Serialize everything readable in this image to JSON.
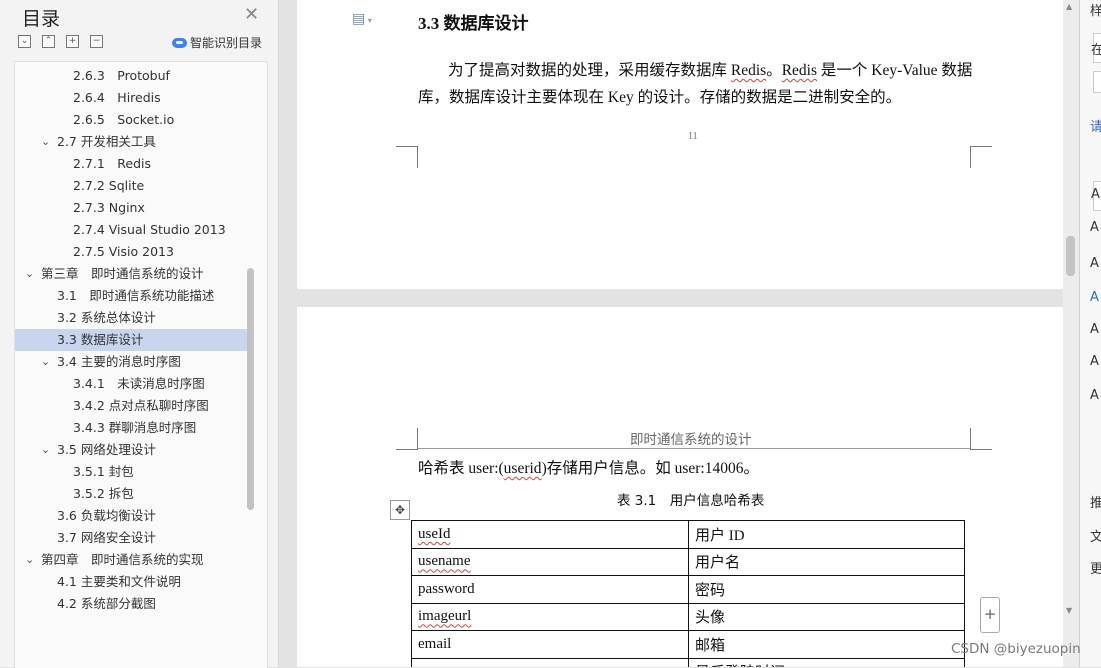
{
  "toc": {
    "title": "目录",
    "smart_label": "智能识别目录",
    "items": [
      {
        "label": "2.6.3　Protobuf"
      },
      {
        "label": "2.6.4　Hiredis"
      },
      {
        "label": "2.6.5　Socket.io"
      },
      {
        "label": "2.7 开发相关工具"
      },
      {
        "label": "2.7.1　Redis"
      },
      {
        "label": "2.7.2 Sqlite"
      },
      {
        "label": "2.7.3 Nginx"
      },
      {
        "label": "2.7.4 Visual Studio 2013"
      },
      {
        "label": "2.7.5 Visio 2013"
      },
      {
        "label": "第三章　即时通信系统的设计"
      },
      {
        "label": "3.1　即时通信系统功能描述"
      },
      {
        "label": "3.2 系统总体设计"
      },
      {
        "label": "3.3 数据库设计"
      },
      {
        "label": "3.4 主要的消息时序图"
      },
      {
        "label": "3.4.1　未读消息时序图"
      },
      {
        "label": "3.4.2 点对点私聊时序图"
      },
      {
        "label": "3.4.3 群聊消息时序图"
      },
      {
        "label": "3.5 网络处理设计"
      },
      {
        "label": "3.5.1 封包"
      },
      {
        "label": "3.5.2 拆包"
      },
      {
        "label": "3.6 负载均衡设计"
      },
      {
        "label": "3.7 网络安全设计"
      },
      {
        "label": "第四章　即时通信系统的实现"
      },
      {
        "label": "4.1 主要类和文件说明"
      },
      {
        "label": "4.2 系统部分截图"
      }
    ],
    "selected_label": "3.3 数据库设计"
  },
  "page1": {
    "heading": "3.3 数据库设计",
    "para_a": "为了提高对数据的处理，采用缓存数据库 ",
    "para_redis1": "Redis",
    "para_b": "。",
    "para_redis2": "Redis",
    "para_c": " 是一个 Key-Value 数据库，数据库设计主要体现在 Key 的设计。存储的数据是二进制安全的。",
    "page_number": "11"
  },
  "page2": {
    "header": "即时通信系统的设计",
    "hash_a": "哈希表 user:(",
    "hash_userid": "userid",
    "hash_b": ")存储用户信息。如 user:14006。",
    "caption": "表 3.1　用户信息哈希表",
    "table": [
      {
        "field": "useId",
        "desc": "用户 ID"
      },
      {
        "field": "usename",
        "desc": "用户名"
      },
      {
        "field": "password",
        "desc": "密码"
      },
      {
        "field": "imageurl",
        "desc": "头像"
      },
      {
        "field": "email",
        "desc": "邮箱"
      },
      {
        "field": "",
        "desc": "最后登陆时间"
      }
    ]
  },
  "right_panel": {
    "chars": [
      "样",
      "在",
      "请",
      "A",
      "A",
      "A",
      "A",
      "A",
      "A",
      "A",
      "推",
      "文",
      "更"
    ]
  },
  "watermark": "CSDN @biyezuopin"
}
